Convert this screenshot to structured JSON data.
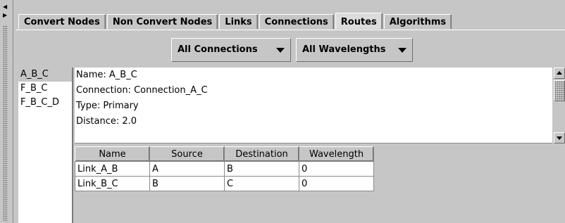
{
  "tabs": [
    "Convert Nodes",
    "Non Convert Nodes",
    "Links",
    "Connections",
    "Routes",
    "Algorithms"
  ],
  "active_tab": "Routes",
  "filters": {
    "connection": "All Connections",
    "wavelength": "All Wavelengths"
  },
  "routes": [
    "A_B_C",
    "F_B_C",
    "F_B_C_D"
  ],
  "selected_route": "A_B_C",
  "details": {
    "name": "Name: A_B_C",
    "connection": "Connection: Connection_A_C",
    "type": "Type: Primary",
    "distance": "Distance: 2.0"
  },
  "links_table": {
    "columns": [
      "Name",
      "Source",
      "Destination",
      "Wavelength"
    ],
    "rows": [
      [
        "Link_A_B",
        "A",
        "B",
        "0"
      ],
      [
        "Link_B_C",
        "B",
        "C",
        "0"
      ]
    ]
  }
}
